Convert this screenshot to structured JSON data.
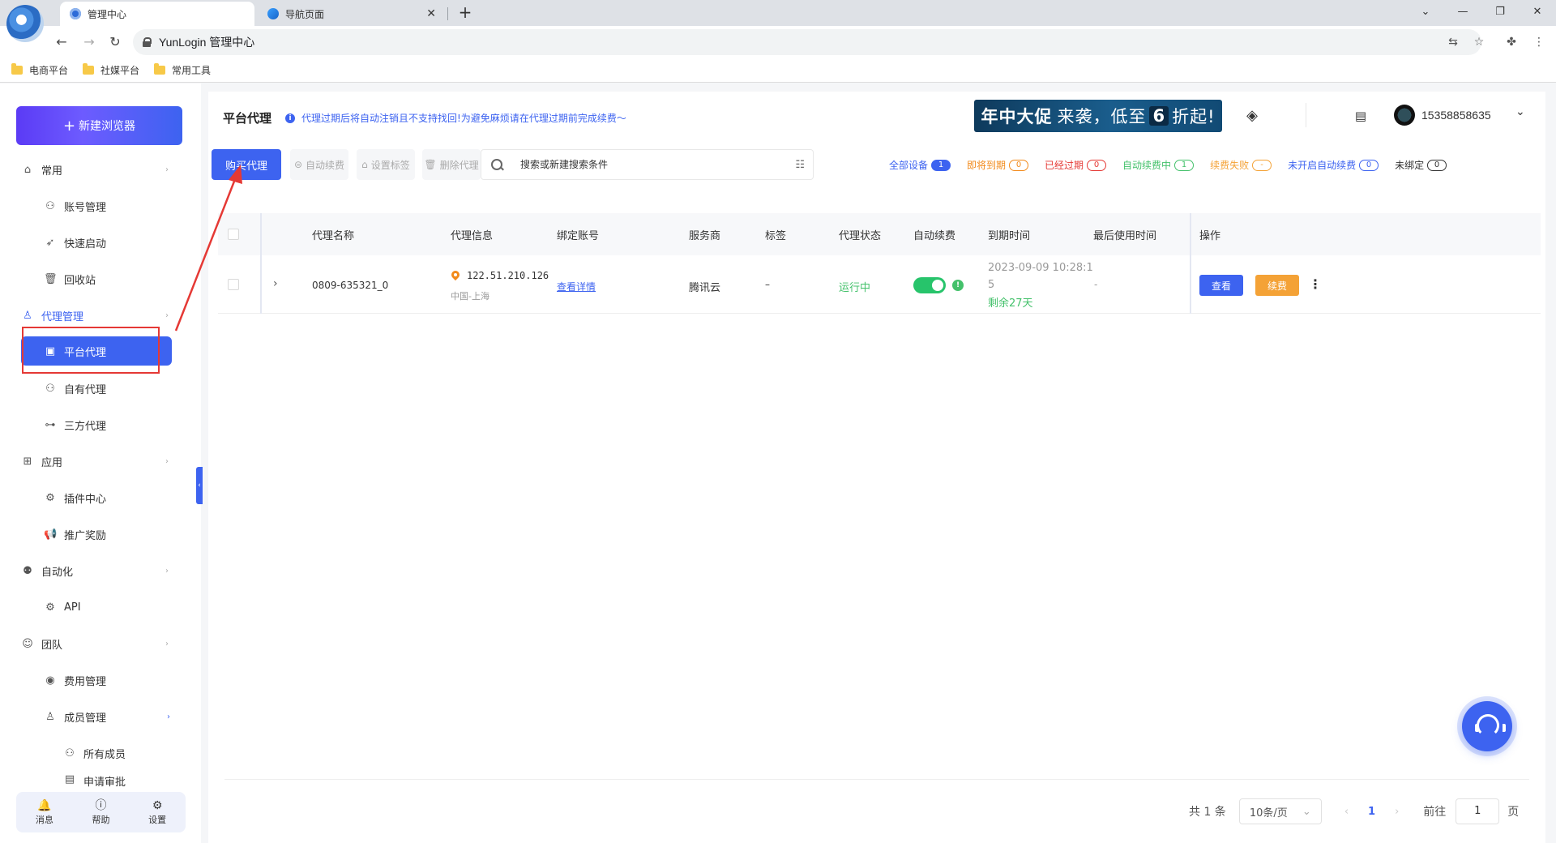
{
  "browser": {
    "tabs": [
      {
        "title": "管理中心",
        "active": true
      },
      {
        "title": "导航页面",
        "active": false
      }
    ],
    "url": "YunLogin 管理中心",
    "bookmarks": [
      "电商平台",
      "社媒平台",
      "常用工具"
    ]
  },
  "sidebar": {
    "new_browser_label": "新建浏览器",
    "menu": [
      {
        "label": "常用",
        "icon": "home-icon"
      },
      {
        "label": "账号管理",
        "icon": "user-manage-icon"
      },
      {
        "label": "快速启动",
        "icon": "rocket-icon"
      },
      {
        "label": "回收站",
        "icon": "trash-icon"
      },
      {
        "label": "代理管理",
        "icon": "proxy-icon"
      },
      {
        "label": "平台代理",
        "icon": "platform-proxy-icon"
      },
      {
        "label": "自有代理",
        "icon": "own-proxy-icon"
      },
      {
        "label": "三方代理",
        "icon": "network-icon"
      },
      {
        "label": "应用",
        "icon": "apps-icon"
      },
      {
        "label": "插件中心",
        "icon": "plugin-icon"
      },
      {
        "label": "推广奖励",
        "icon": "megaphone-icon"
      },
      {
        "label": "自动化",
        "icon": "robot-icon"
      },
      {
        "label": "API",
        "icon": "api-icon"
      },
      {
        "label": "团队",
        "icon": "team-icon"
      },
      {
        "label": "费用管理",
        "icon": "billing-icon"
      },
      {
        "label": "成员管理",
        "icon": "members-icon"
      },
      {
        "label": "所有成员",
        "icon": "all-members-icon"
      },
      {
        "label": "申请审批",
        "icon": "approval-icon"
      }
    ],
    "footer": [
      {
        "label": "消息",
        "icon": "bell-icon"
      },
      {
        "label": "帮助",
        "icon": "help-icon"
      },
      {
        "label": "设置",
        "icon": "gear-icon"
      }
    ]
  },
  "header": {
    "title": "平台代理",
    "notice": "代理过期后将自动注销且不支持找回!为避免麻烦请在代理过期前完成续费～",
    "promo_strong": "年中大促",
    "promo_light": "来袭，低至",
    "promo_num": "6",
    "promo_tail": "折起!",
    "user_phone": "15358858635"
  },
  "toolbar": {
    "buy_proxy": "购买代理",
    "auto_renew": "自动续费",
    "set_tags": "设置标签",
    "delete_proxy": "删除代理",
    "search_placeholder": "搜索或新建搜索条件"
  },
  "filters": [
    {
      "label": "全部设备",
      "count": "1",
      "color": "#3d63f0"
    },
    {
      "label": "即将到期",
      "count": "0",
      "color": "#f28a1a"
    },
    {
      "label": "已经过期",
      "count": "0",
      "color": "#e53935"
    },
    {
      "label": "自动续费中",
      "count": "1",
      "color": "#44c16b"
    },
    {
      "label": "续费失败",
      "count": "-",
      "color": "#f4a236"
    },
    {
      "label": "未开启自动续费",
      "count": "0",
      "color": "#3d63f0"
    },
    {
      "label": "未绑定",
      "count": "0",
      "color": "#333333"
    }
  ],
  "table": {
    "columns": [
      "代理名称",
      "代理信息",
      "绑定账号",
      "服务商",
      "标签",
      "代理状态",
      "自动续费",
      "到期时间",
      "最后使用时间",
      "操作"
    ],
    "rows": [
      {
        "name": "0809-635321_0",
        "ip": "122.51.210.126",
        "region": "中国-上海",
        "account": "查看详情",
        "provider": "腾讯云",
        "tag": "–",
        "status": "运行中",
        "auto_renew": true,
        "expire_line1": "2023-09-09 10:28:1",
        "expire_line2": "5",
        "remaining": "剩余27天",
        "last_used": "-",
        "view": "查看",
        "renew": "续费"
      }
    ]
  },
  "pagination": {
    "total": "共 1 条",
    "page_size": "10条/页",
    "current": "1",
    "goto_label": "前往",
    "goto_value": "1",
    "suffix": "页"
  }
}
